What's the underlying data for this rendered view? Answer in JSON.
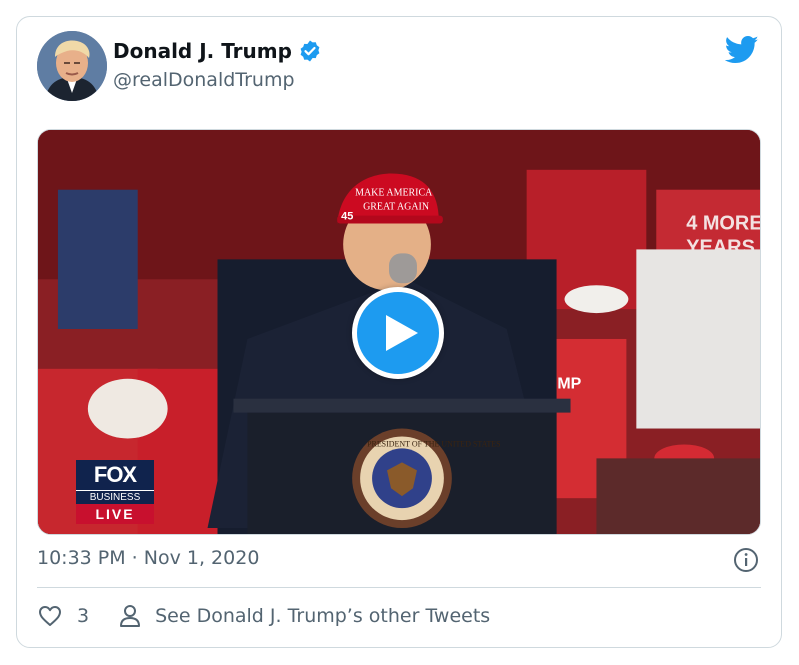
{
  "author": {
    "display_name": "Donald J. Trump",
    "handle": "@realDonaldTrump",
    "verified": true
  },
  "media": {
    "type": "video",
    "hat_text_line1": "MAKE AMERICA",
    "hat_text_line2": "GREAT AGAIN",
    "hat_side_number": "45",
    "sign_text_line1": "4 MORE",
    "sign_text_line2": "YEARS",
    "shirt_text": "TRUMP",
    "seal_text": "PRESIDENT OF THE UNITED STATES",
    "broadcast_badge": {
      "top": "FOX",
      "middle": "BUSINESS",
      "live": "LIVE"
    }
  },
  "meta": {
    "timestamp": "10:33 PM · Nov 1, 2020"
  },
  "actions": {
    "like_count": "3",
    "profile_link_label": "See Donald J. Trump’s other Tweets"
  },
  "icons": {
    "brand": "twitter-bird-icon",
    "verified": "verified-badge-icon",
    "info": "info-icon",
    "like": "heart-icon",
    "profile": "person-icon",
    "play": "play-icon"
  },
  "colors": {
    "twitter_blue": "#1d9bf0",
    "text_primary": "#0f1419",
    "text_secondary": "#536471",
    "border": "#cfd9de",
    "hat_red": "#c8102e"
  }
}
